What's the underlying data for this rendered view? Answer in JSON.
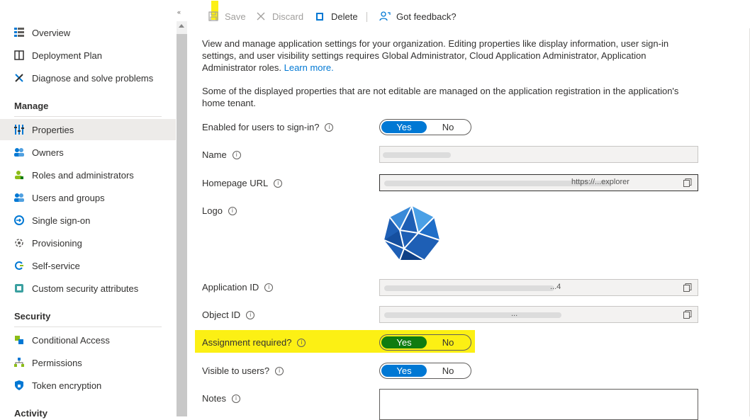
{
  "sidebar": {
    "items_top": [
      {
        "label": "Overview",
        "icon": "overview-icon"
      },
      {
        "label": "Deployment Plan",
        "icon": "book-icon"
      },
      {
        "label": "Diagnose and solve problems",
        "icon": "wrench-icon"
      }
    ],
    "manage_header": "Manage",
    "manage_items": [
      {
        "label": "Properties",
        "icon": "properties-icon",
        "selected": true
      },
      {
        "label": "Owners",
        "icon": "owners-icon"
      },
      {
        "label": "Roles and administrators",
        "icon": "roles-icon"
      },
      {
        "label": "Users and groups",
        "icon": "users-groups-icon"
      },
      {
        "label": "Single sign-on",
        "icon": "sso-icon"
      },
      {
        "label": "Provisioning",
        "icon": "provisioning-icon"
      },
      {
        "label": "Self-service",
        "icon": "self-service-icon"
      },
      {
        "label": "Custom security attributes",
        "icon": "custom-attributes-icon"
      }
    ],
    "security_header": "Security",
    "security_items": [
      {
        "label": "Conditional Access",
        "icon": "conditional-access-icon"
      },
      {
        "label": "Permissions",
        "icon": "permissions-icon"
      },
      {
        "label": "Token encryption",
        "icon": "shield-icon"
      }
    ],
    "activity_header": "Activity",
    "collapse": "«"
  },
  "toolbar": {
    "save_label": "Save",
    "discard_label": "Discard",
    "delete_label": "Delete",
    "feedback_label": "Got feedback?"
  },
  "content": {
    "intro": "View and manage application settings for your organization. Editing properties like display information, user sign-in settings, and user visibility settings requires Global Administrator, Cloud Application Administrator, Application Administrator roles.",
    "learn_more": "Learn more.",
    "note": "Some of the displayed properties that are not editable are managed on the application registration in the application's home tenant.",
    "enabled_label": "Enabled for users to sign-in?",
    "name_label": "Name",
    "homepage_label": "Homepage URL",
    "homepage_value": "https://...explorer",
    "logo_label": "Logo",
    "appid_label": "Application ID",
    "appid_value": "...4",
    "objectid_label": "Object ID",
    "objectid_value": "...",
    "assignment_label": "Assignment required?",
    "visible_label": "Visible to users?",
    "notes_label": "Notes",
    "yes": "Yes",
    "no": "No",
    "info": "i"
  },
  "colors": {
    "accent": "#0078d4",
    "green": "#107c10",
    "highlight": "#fcf014"
  }
}
